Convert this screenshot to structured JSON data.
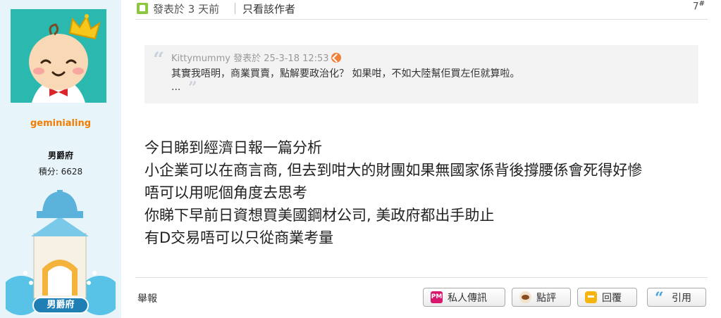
{
  "user": {
    "name": "geminialing",
    "rank": "男爵府",
    "points": "積分: 6628",
    "badge_label": "男爵府",
    "avatar_icon": "baby-prince-avatar",
    "badge_icon": "castle-tower-badge"
  },
  "header": {
    "posted_time": "發表於 3 天前",
    "only_author": "只看該作者",
    "post_number": "7",
    "post_number_mark": "#"
  },
  "quote": {
    "author": "Kittymummy",
    "posted": "發表於 25-3-18 12:53",
    "text": "其實我唔明，商業買賣，點解要政治化？ 如果咁，不如大陸幫佢買左佢就算啦。",
    "ellipsis": "..."
  },
  "post": {
    "lines": [
      "今日睇到經濟日報一篇分析",
      "小企業可以在商言商, 但去到咁大的財團如果無國家係背後撐腰係會死得好慘",
      "唔可以用呢個角度去思考",
      "你睇下早前日資想買美國鋼材公司, 美政府都出手助止",
      "有D交易唔可以只從商業考量"
    ]
  },
  "footer": {
    "report": "舉報",
    "pm": "私人傳訊",
    "pm_icon_text": "PM",
    "rate": "點評",
    "reply": "回覆",
    "quote": "引用"
  },
  "colors": {
    "username": "#f27d00",
    "sidebar_bg": "#e7f4fa",
    "avatar_bg": "#2bb8ae",
    "quote_bg": "#f3f3f3"
  }
}
